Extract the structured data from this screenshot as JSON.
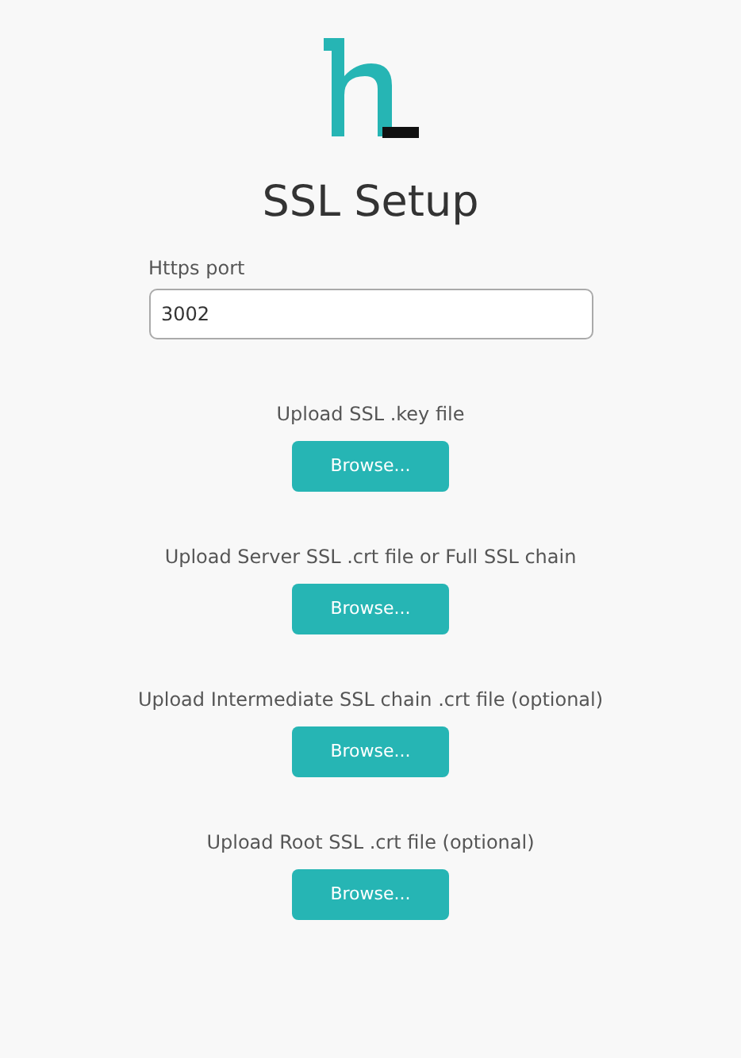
{
  "title": "SSL Setup",
  "port": {
    "label": "Https port",
    "value": "3002"
  },
  "uploads": [
    {
      "label": "Upload SSL .key file",
      "button": "Browse..."
    },
    {
      "label": "Upload Server SSL .crt file or Full SSL chain",
      "button": "Browse..."
    },
    {
      "label": "Upload Intermediate SSL chain .crt file (optional)",
      "button": "Browse..."
    },
    {
      "label": "Upload Root SSL .crt file (optional)",
      "button": "Browse..."
    }
  ]
}
